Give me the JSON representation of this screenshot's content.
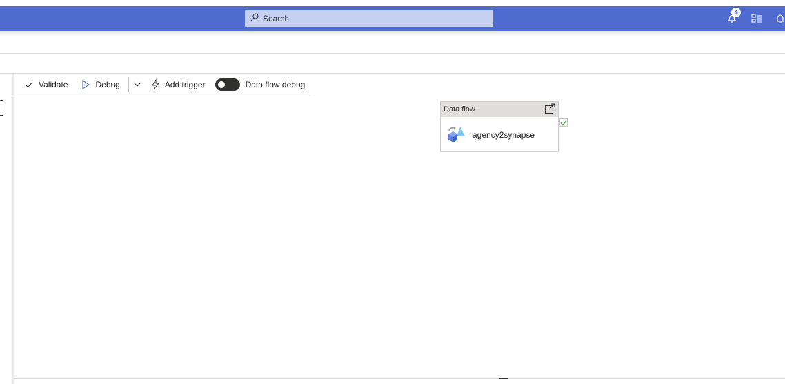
{
  "header": {
    "search_placeholder": "Search",
    "notifications_count": "4",
    "brand_color": "#4f6bd0"
  },
  "toolbar": {
    "validate_label": "Validate",
    "debug_label": "Debug",
    "add_trigger_label": "Add trigger",
    "data_flow_debug_label": "Data flow debug",
    "data_flow_debug_on": false
  },
  "activity": {
    "type_label": "Data flow",
    "name": "agency2synapse",
    "status": "succeeded"
  },
  "icons": {
    "search": "search-icon",
    "notifications": "bell-icon",
    "directory": "directory-icon",
    "alerts": "alerts-icon",
    "validate": "check-icon",
    "debug": "play-icon",
    "chevron": "chevron-down-icon",
    "trigger": "lightning-icon",
    "open": "open-external-icon",
    "dataflow": "data-flow-icon",
    "status": "checkbox-checked-icon"
  }
}
